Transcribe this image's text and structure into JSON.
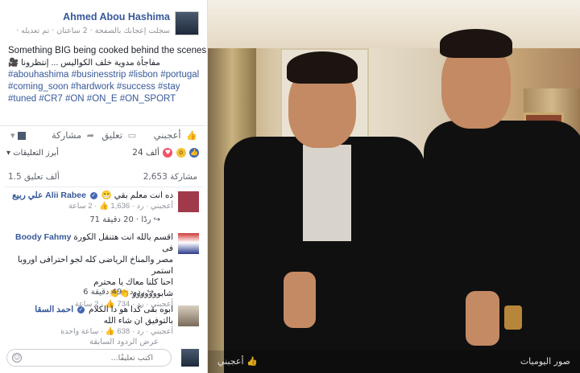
{
  "header": {
    "page_name": "Ahmed Abou Hashima",
    "meta": "سجلت إعجابك بالصفحة · 2 ساعتان · تم تعديله ·"
  },
  "post": {
    "line1": "Something BIG being cooked behind the scenes",
    "line2": "مفاجأة مدوية خلف الكواليس ... إنتظرونا 🎥",
    "tags1": "#abouhashima #businesstrip #lisbon #portugal",
    "tags2": "#coming_soon #hardwork #success #stay",
    "tags3": "#tuned #CR7 #ON #ON_E #ON_SPORT"
  },
  "actions": {
    "like": "أعجبني",
    "comment": "تعليق",
    "share": "مشاركة"
  },
  "sort": "أبرز التعليقات",
  "reactions_count": "24 ألف",
  "stats": {
    "shares": "2,653 مشاركة",
    "comments": "1.5 ألف تعليق"
  },
  "comments": [
    {
      "name_ar": "علي ربيع",
      "name_en": "Alii Rabee",
      "text": "ده انت معلم بقي 😁",
      "meta": "أعجبني · رد · 1,636 👍 · 2 ساعة",
      "replies": "71 ردًا · 20 دقيقة"
    },
    {
      "name_en": "Boody Fahmy",
      "text1": "اقسم بالله انت هتنقل الكورة فى",
      "text2": "مصر والمناخ الرياضى كله لجو احترافى اوروبا استمر",
      "text3": "احنا كلنا معاك يا محترم",
      "text4": "شابووووووو 👏👏",
      "meta": "أعجبني · رد · 734 👍 · 2 ساعة",
      "replies": "6 ردود · 49 دقيقة"
    },
    {
      "name_ar": "احمد السقا",
      "text1": "ابوه بقى كدا هو دا الكلام",
      "text2": "بالتوفيق ان شاء الله",
      "meta": "أعجبني · رد · 638 👍 · ساعة واحدة",
      "replies": "عرض الردود السابقة"
    }
  ],
  "composer": {
    "placeholder": "اكتب تعليقًا..."
  },
  "photo": {
    "like_btn": "أعجبني",
    "album": "صور اليوميات"
  },
  "colors": {
    "link": "#365899",
    "like_blue": "#4267b2",
    "love_red": "#f25268",
    "wow_yellow": "#f5c33b"
  }
}
